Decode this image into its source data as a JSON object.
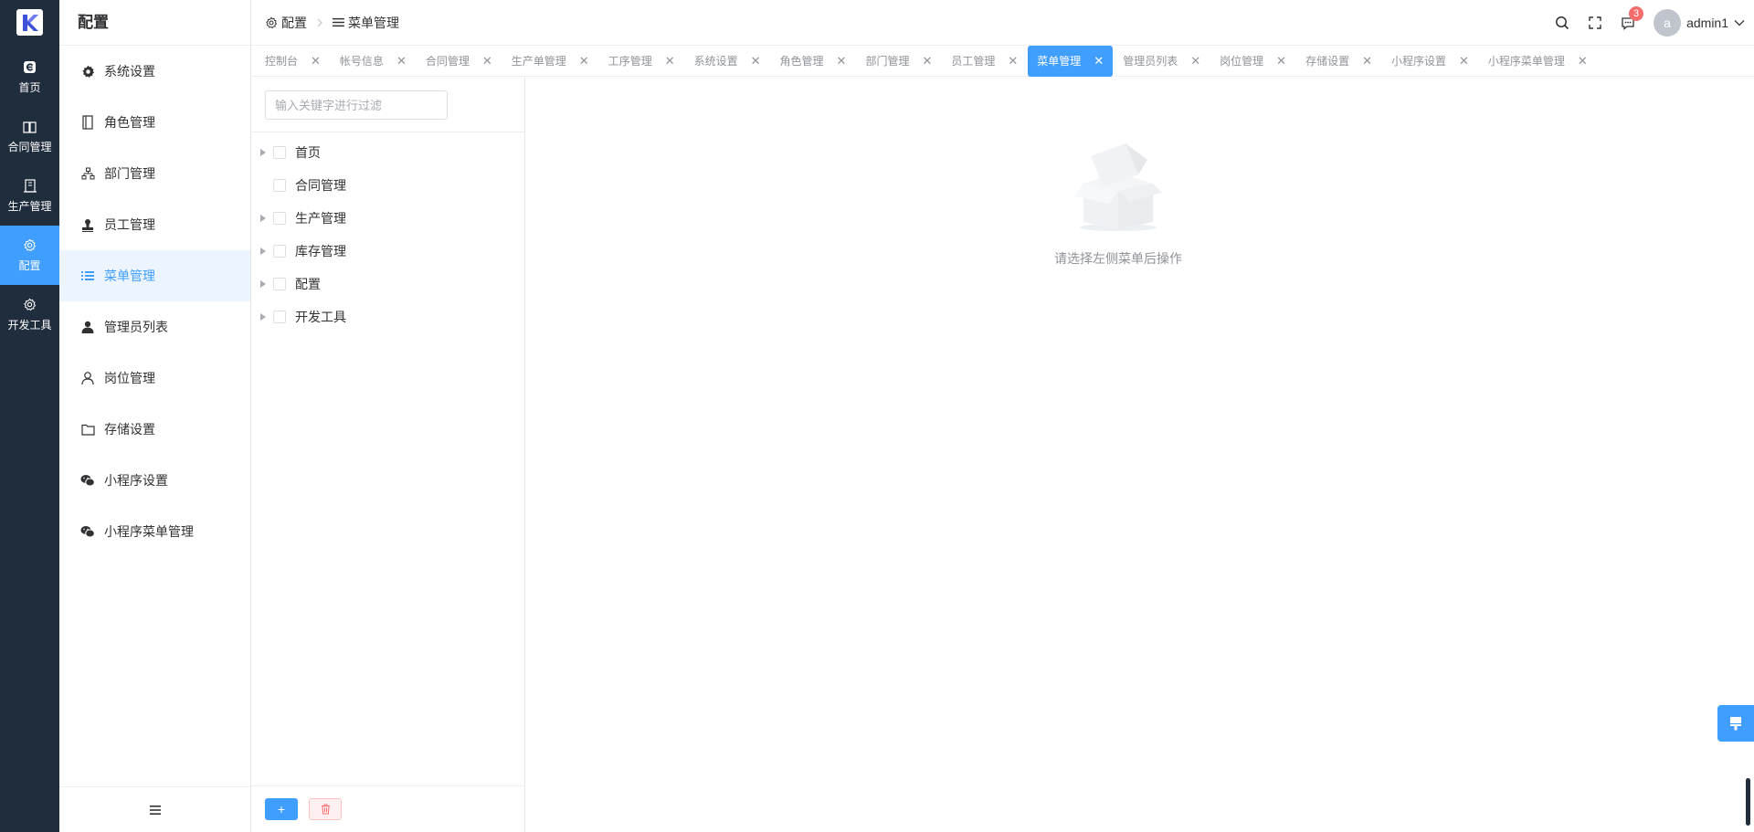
{
  "rail": {
    "items": [
      {
        "label": "首页",
        "icon": "home-icon"
      },
      {
        "label": "合同管理",
        "icon": "book-icon"
      },
      {
        "label": "生产管理",
        "icon": "building-icon"
      },
      {
        "label": "配置",
        "icon": "gear-icon"
      },
      {
        "label": "开发工具",
        "icon": "gear-icon"
      }
    ],
    "active_index": 3
  },
  "submenu": {
    "title": "配置",
    "items": [
      {
        "label": "系统设置",
        "icon": "gear-filled-icon"
      },
      {
        "label": "角色管理",
        "icon": "notebook-icon"
      },
      {
        "label": "部门管理",
        "icon": "org-chart-icon"
      },
      {
        "label": "员工管理",
        "icon": "stamp-icon"
      },
      {
        "label": "菜单管理",
        "icon": "menu-list-icon"
      },
      {
        "label": "管理员列表",
        "icon": "user-filled-icon"
      },
      {
        "label": "岗位管理",
        "icon": "user-outline-icon"
      },
      {
        "label": "存储设置",
        "icon": "folder-icon"
      },
      {
        "label": "小程序设置",
        "icon": "wechat-icon"
      },
      {
        "label": "小程序菜单管理",
        "icon": "wechat-icon"
      }
    ],
    "active_index": 4
  },
  "breadcrumb": [
    {
      "label": "配置",
      "icon": "gear-icon"
    },
    {
      "label": "菜单管理",
      "icon": "menu-list-icon"
    }
  ],
  "header": {
    "notification_count": "3",
    "avatar_letter": "a",
    "username": "admin1"
  },
  "tabs": [
    {
      "label": "控制台"
    },
    {
      "label": "帐号信息"
    },
    {
      "label": "合同管理"
    },
    {
      "label": "生产单管理"
    },
    {
      "label": "工序管理"
    },
    {
      "label": "系统设置"
    },
    {
      "label": "角色管理"
    },
    {
      "label": "部门管理"
    },
    {
      "label": "员工管理"
    },
    {
      "label": "菜单管理",
      "active": true
    },
    {
      "label": "管理员列表"
    },
    {
      "label": "岗位管理"
    },
    {
      "label": "存储设置"
    },
    {
      "label": "小程序设置"
    },
    {
      "label": "小程序菜单管理"
    }
  ],
  "tree": {
    "filter_placeholder": "输入关键字进行过滤",
    "filter_value": "",
    "nodes": [
      {
        "label": "首页",
        "expandable": true
      },
      {
        "label": "合同管理",
        "expandable": false
      },
      {
        "label": "生产管理",
        "expandable": true
      },
      {
        "label": "库存管理",
        "expandable": true
      },
      {
        "label": "配置",
        "expandable": true
      },
      {
        "label": "开发工具",
        "expandable": true
      }
    ],
    "add_label": "+"
  },
  "content": {
    "empty_text": "请选择左侧菜单后操作"
  },
  "colors": {
    "rail_bg": "#1f2d3d",
    "accent": "#409eff",
    "danger": "#f56c6c"
  }
}
